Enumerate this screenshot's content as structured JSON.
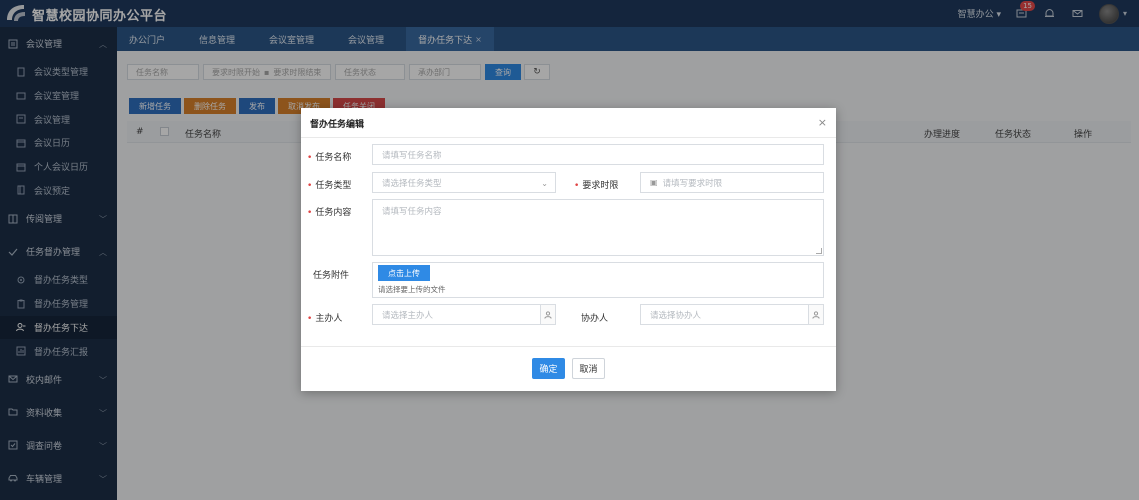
{
  "app": {
    "title": "智慧校园协同办公平台",
    "user_menu": "智慧办公 ▾",
    "notification_count": "15"
  },
  "sidebar": {
    "groups": [
      {
        "label": "会议管理",
        "icon": "meeting-icon"
      },
      {
        "label": "传阅管理",
        "icon": "circulate-icon"
      },
      {
        "label": "任务督办管理",
        "icon": "task-icon"
      },
      {
        "label": "校内邮件",
        "icon": "mail-icon"
      },
      {
        "label": "资料收集",
        "icon": "folder-icon"
      },
      {
        "label": "调查问卷",
        "icon": "survey-icon"
      },
      {
        "label": "车辆管理",
        "icon": "car-icon"
      }
    ],
    "meeting_items": [
      "会议类型管理",
      "会议室管理",
      "会议管理",
      "会议日历",
      "个人会议日历",
      "会议预定"
    ],
    "task_items": [
      "督办任务类型",
      "督办任务管理",
      "督办任务下达",
      "督办任务汇报"
    ]
  },
  "tabs": [
    {
      "label": "办公门户"
    },
    {
      "label": "信息管理"
    },
    {
      "label": "会议室管理"
    },
    {
      "label": "会议管理"
    },
    {
      "label": "督办任务下达"
    }
  ],
  "filters": {
    "task_name": "任务名称",
    "date_start": "要求时限开始",
    "date_end": "要求时限结束",
    "status": "任务状态",
    "dept": "承办部门",
    "query_label": "查询"
  },
  "actions": {
    "add": "新增任务",
    "delete": "删除任务",
    "publish": "发布",
    "cancel_publish": "取消发布",
    "end": "任务关闭"
  },
  "table": {
    "headers": [
      "#",
      "任务名称",
      "办理进度",
      "任务状态",
      "操作"
    ]
  },
  "modal": {
    "title": "督办任务编辑",
    "fields": {
      "task_name_label": "任务名称",
      "task_name_placeholder": "请填写任务名称",
      "task_type_label": "任务类型",
      "task_type_placeholder": "请选择任务类型",
      "deadline_label": "要求时限",
      "deadline_placeholder": "请填写要求时限",
      "content_label": "任务内容",
      "content_placeholder": "请填写任务内容",
      "attachment_label": "任务附件",
      "upload_label": "点击上传",
      "upload_hint": "请选择要上传的文件",
      "host_label": "主办人",
      "host_placeholder": "请选择主办人",
      "assist_label": "协办人",
      "assist_placeholder": "请选择协办人"
    },
    "ok": "确定",
    "cancel": "取消"
  },
  "colors": {
    "topbar": "#1f3a5f",
    "sidebar": "#1d2f47",
    "tabbar": "#2c5788",
    "primary": "#2f8ae5",
    "btn_blue": "#2f6fbf",
    "btn_orange": "#d9822b",
    "btn_red": "#d94a4a"
  }
}
